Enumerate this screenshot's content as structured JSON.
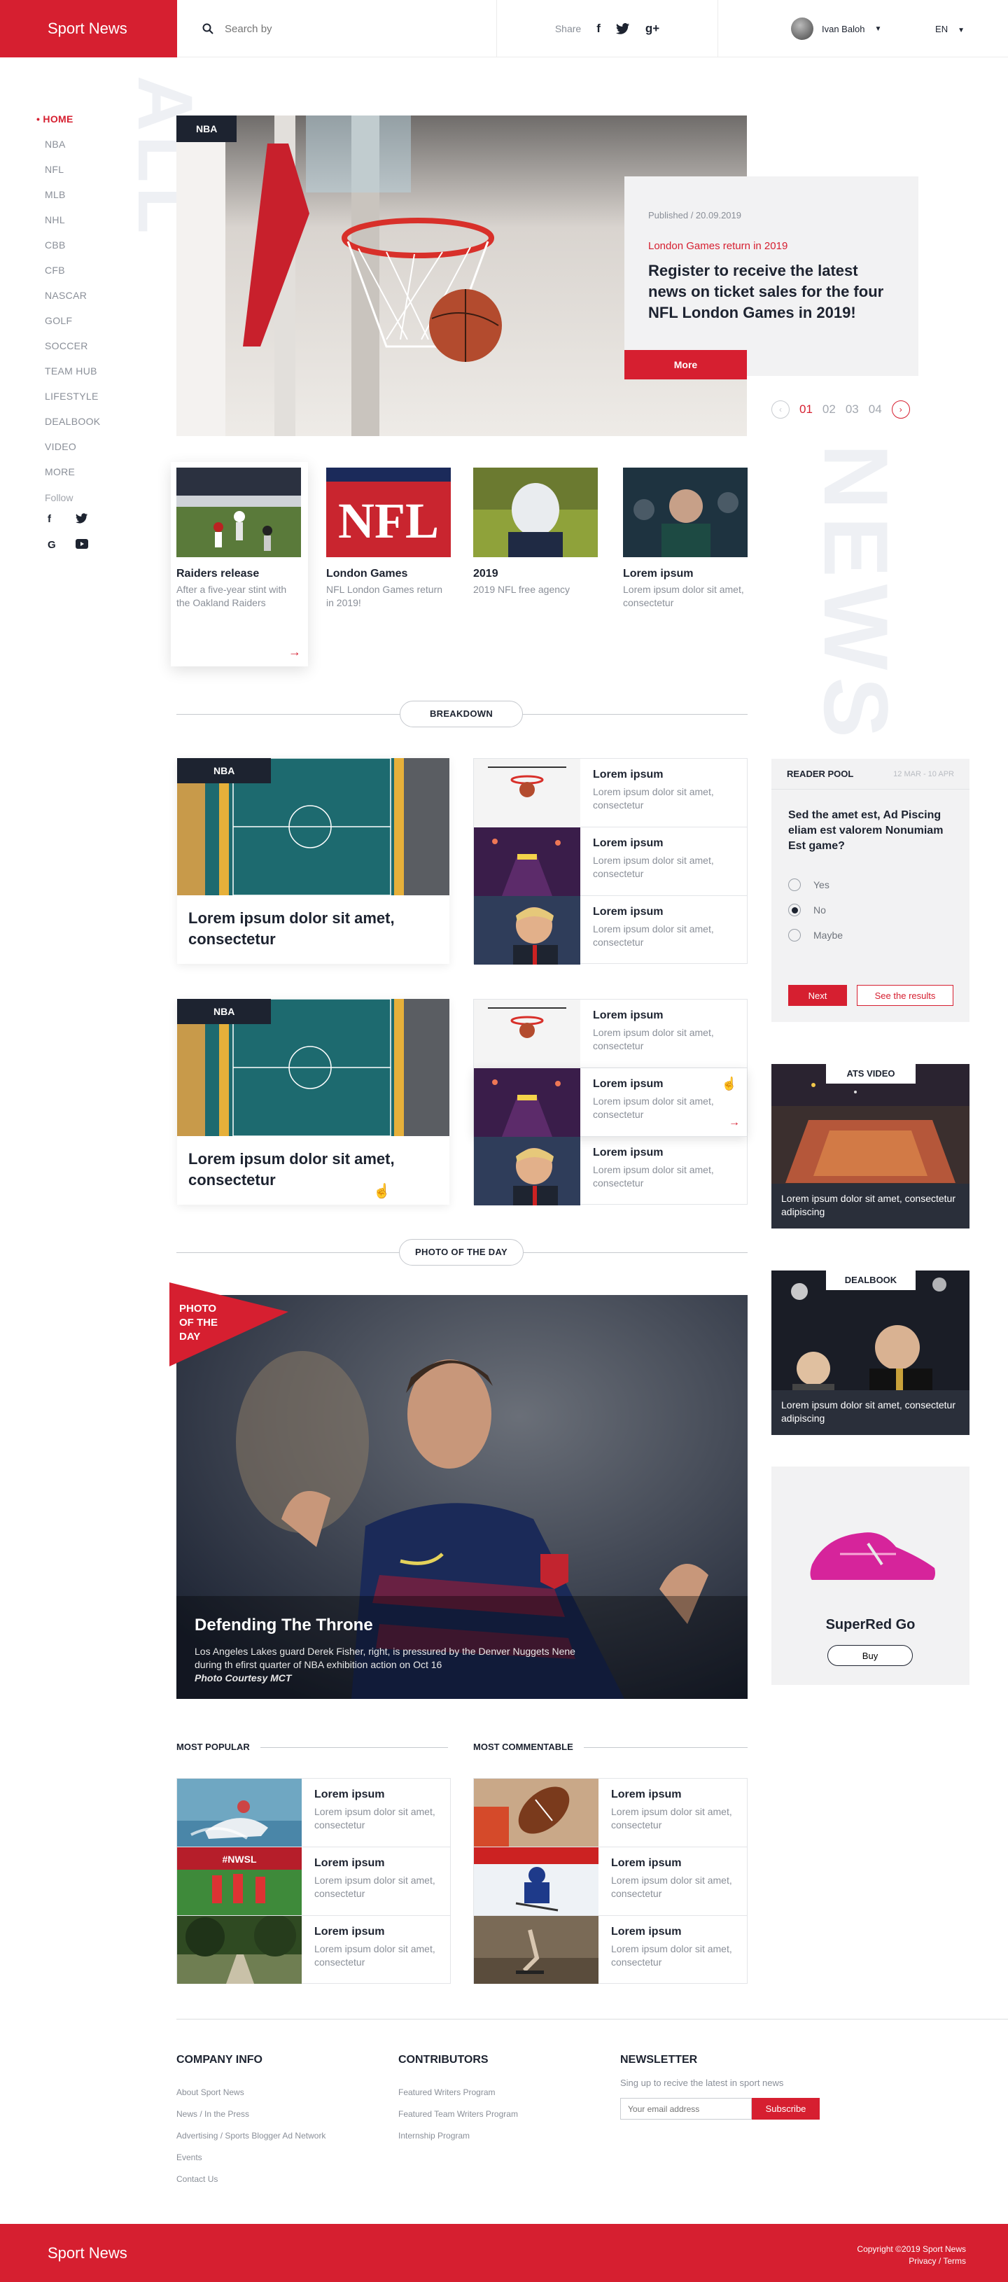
{
  "header": {
    "brand": "Sport News",
    "search_placeholder": "Search by",
    "share_label": "Share",
    "share_icons": {
      "facebook": "f",
      "twitter": "t",
      "google_plus": "g+"
    },
    "user_name": "Ivan Baloh",
    "language": "EN"
  },
  "sidebar": {
    "items": [
      {
        "label": "HOME"
      },
      {
        "label": "NBA"
      },
      {
        "label": "NFL"
      },
      {
        "label": "MLB"
      },
      {
        "label": "NHL"
      },
      {
        "label": "CBB"
      },
      {
        "label": "CFB"
      },
      {
        "label": "NASCAR"
      },
      {
        "label": "GOLF"
      },
      {
        "label": "SOCCER"
      },
      {
        "label": "TEAM HUB"
      },
      {
        "label": "LIFESTYLE"
      },
      {
        "label": "DEALBOOK"
      },
      {
        "label": "VIDEO"
      },
      {
        "label": "MORE"
      }
    ],
    "follow_label": "Follow",
    "vertical_word": "ALL"
  },
  "hero": {
    "tag": "NBA",
    "published": "Published / 20.09.2019",
    "subtitle": "London Games return in 2019",
    "headline": "Register to receive the latest news on ticket sales for the four NFL London Games in 2019!",
    "more_label": "More",
    "pages": [
      "01",
      "02",
      "03",
      "04"
    ],
    "vertical_word": "NEWS"
  },
  "thumbs": [
    {
      "title": "Raiders release",
      "text": "After a five-year stint with the Oakland Raiders"
    },
    {
      "title": "London Games",
      "text": "NFL London Games return in 2019!"
    },
    {
      "title": "2019",
      "text": "2019 NFL free agency"
    },
    {
      "title": "Lorem ipsum",
      "text": "Lorem ipsum dolor sit amet, consectetur"
    }
  ],
  "breakdown": {
    "label": "BREAKDOWN",
    "groups": [
      {
        "tag": "NBA",
        "title": "Lorem ipsum dolor sit amet, consectetur",
        "rows": [
          {
            "title": "Lorem ipsum",
            "text": "Lorem ipsum dolor sit amet, consectetur"
          },
          {
            "title": "Lorem ipsum",
            "text": "Lorem ipsum dolor sit amet, consectetur"
          },
          {
            "title": "Lorem ipsum",
            "text": "Lorem ipsum dolor sit amet, consectetur"
          }
        ]
      },
      {
        "tag": "NBA",
        "title": "Lorem ipsum dolor sit amet, consectetur",
        "rows": [
          {
            "title": "Lorem ipsum",
            "text": "Lorem ipsum dolor sit amet, consectetur"
          },
          {
            "title": "Lorem ipsum",
            "text": "Lorem ipsum dolor sit amet, consectetur"
          },
          {
            "title": "Lorem ipsum",
            "text": "Lorem ipsum dolor sit amet, consectetur"
          }
        ]
      }
    ]
  },
  "poll": {
    "title": "READER POOL",
    "dates": "12 MAR - 10 APR",
    "question": "Sed the amet est, Ad Piscing eliam est valorem Nonumiam Est game?",
    "options": [
      "Yes",
      "No",
      "Maybe"
    ],
    "selected": "No",
    "next_label": "Next",
    "results_label": "See the results"
  },
  "side_video": {
    "label": "ATS VIDEO",
    "caption": "Lorem ipsum dolor sit amet, consectetur adipiscing"
  },
  "side_dealbook": {
    "label": "DEALBOOK",
    "caption": "Lorem ipsum dolor sit amet, consectetur adipiscing"
  },
  "ad": {
    "product": "SuperRed Go",
    "buy_label": "Buy"
  },
  "photo_of_day": {
    "label": "PHOTO OF THE DAY",
    "flag_lines": [
      "PHOTO",
      "OF THE",
      "DAY"
    ],
    "title": "Defending The Throne",
    "text": "Los Angeles Lakes guard Derek Fisher, right, is pressured by the Denver Nuggets Nene during th efirst quarter of NBA exhibition action on Oct 16",
    "credit": "Photo Courtesy MCT"
  },
  "most_popular": {
    "label": "MOST POPULAR",
    "rows": [
      {
        "title": "Lorem ipsum",
        "text": "Lorem ipsum dolor sit amet, consectetur"
      },
      {
        "title": "Lorem ipsum",
        "text": "Lorem ipsum dolor sit amet, consectetur"
      },
      {
        "title": "Lorem ipsum",
        "text": "Lorem ipsum dolor sit amet, consectetur"
      }
    ]
  },
  "most_commentable": {
    "label": "MOST COMMENTABLE",
    "rows": [
      {
        "title": "Lorem ipsum",
        "text": "Lorem ipsum dolor sit amet, consectetur"
      },
      {
        "title": "Lorem ipsum",
        "text": "Lorem ipsum dolor sit amet, consectetur"
      },
      {
        "title": "Lorem ipsum",
        "text": "Lorem ipsum dolor sit amet, consectetur"
      }
    ]
  },
  "footer": {
    "company": {
      "title": "COMPANY INFO",
      "links": [
        "About Sport News",
        "News / In the Press",
        "Advertising / Sports Blogger Ad Network",
        "Events",
        "Contact Us"
      ]
    },
    "contributors": {
      "title": "CONTRIBUTORS",
      "links": [
        "Featured Writers Program",
        "Featured Team Writers Program",
        "Internship Program"
      ]
    },
    "newsletter": {
      "title": "NEWSLETTER",
      "desc": "Sing up to recive the latest in sport news",
      "placeholder": "Your email address",
      "subscribe": "Subscribe"
    },
    "brand": "Sport News",
    "copyright": "Copyright ©2019 Sport News",
    "legal": "Privacy / Terms"
  },
  "colors": {
    "accent": "#d61f30",
    "dark": "#1d2330",
    "muted": "#8a8f98",
    "panel": "#f2f2f3"
  }
}
